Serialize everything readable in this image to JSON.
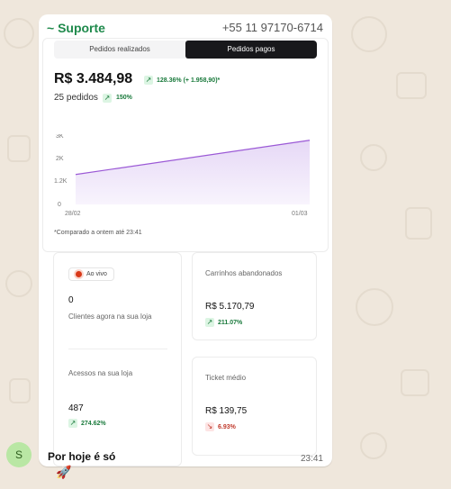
{
  "colors": {
    "brand_green": "#1f8a4c",
    "accent_green": "#1a7a3c",
    "accent_red": "#c0392b",
    "chart_line": "#9b59d6",
    "tab_active_bg": "#18181b"
  },
  "message": {
    "sender": "~ Suporte",
    "phone": "+55 11 97170-6714",
    "footer_text": "Por hoje é só",
    "time": "23:41",
    "avatar_letter": "S",
    "emoji": "🚀"
  },
  "tabs": [
    {
      "label": "Pedidos realizados",
      "active": false
    },
    {
      "label": "Pedidos pagos",
      "active": true
    }
  ],
  "summary": {
    "total": "R$ 3.484,98",
    "total_change": "128.36% (+ 1.958,90)*",
    "orders": "25 pedidos",
    "orders_change": "150%",
    "note": "*Comparado a ontem até 23:41"
  },
  "chart_data": {
    "type": "area",
    "y_ticks": [
      "3K",
      "2K",
      "1.2K",
      "0"
    ],
    "x_ticks": [
      "28/02",
      "01/03"
    ],
    "x": [
      "28/02",
      "01/03"
    ],
    "series": [
      {
        "values": [
          1400,
          3000
        ]
      }
    ],
    "ylim": [
      0,
      3200
    ],
    "grid": false
  },
  "live": {
    "chip_label": "Ao vivo",
    "clients_value": "0",
    "clients_label": "Clientes agora na sua loja",
    "access_label": "Acessos na sua loja",
    "access_value": "487",
    "access_change": "274.62%"
  },
  "abandoned": {
    "label": "Carrinhos abandonados",
    "value": "R$ 5.170,79",
    "change": "211.07%"
  },
  "ticket": {
    "label": "Ticket médio",
    "value": "R$ 139,75",
    "change": "6.93%"
  }
}
